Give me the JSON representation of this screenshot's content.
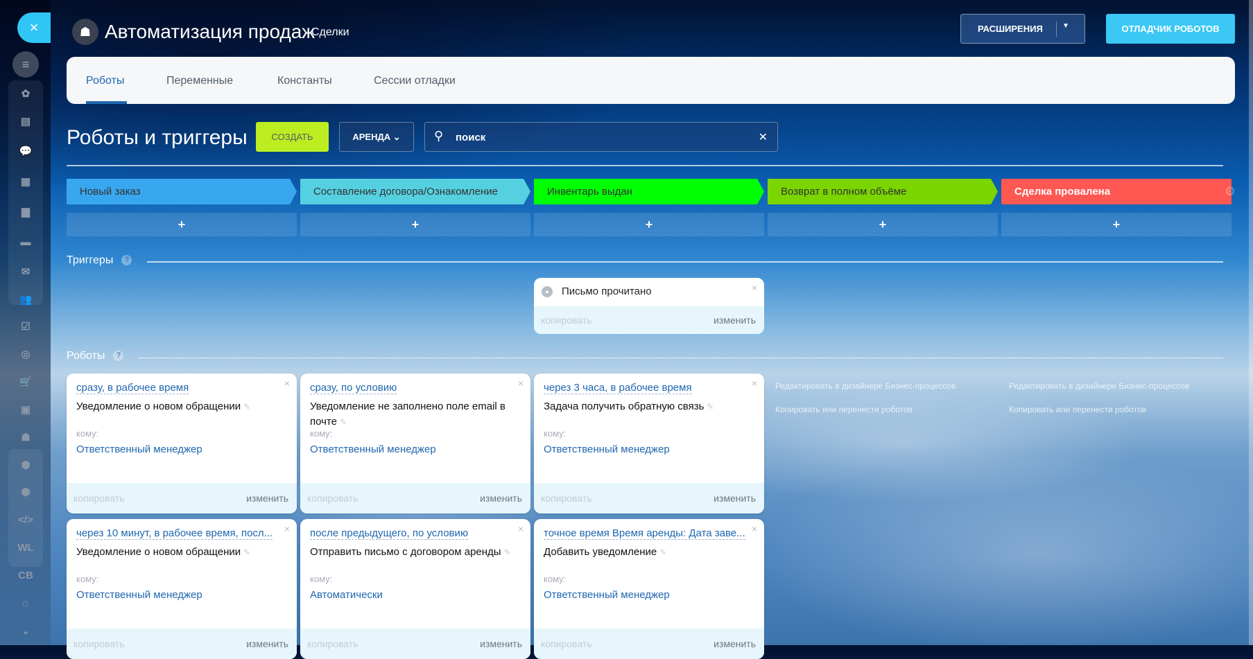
{
  "header": {
    "title": "Автоматизация продаж",
    "subtitle": "Сделки",
    "extensions_label": "РАСШИРЕНИЯ",
    "debugger_label": "ОТЛАДЧИК РОБОТОВ"
  },
  "sidebar": {
    "close": "×",
    "items": [
      {
        "icon": "funnel-icon",
        "g": "≡"
      },
      {
        "icon": "crm-icon",
        "g": "✿"
      },
      {
        "icon": "window-icon",
        "g": "▤"
      },
      {
        "icon": "chat-icon",
        "g": "💬"
      },
      {
        "icon": "calendar-icon",
        "g": "▦"
      },
      {
        "icon": "document-icon",
        "g": "▆"
      },
      {
        "icon": "drive-icon",
        "g": "▬"
      },
      {
        "icon": "mail-icon",
        "g": "✉"
      },
      {
        "icon": "users-icon",
        "g": "👥"
      },
      {
        "icon": "tasks-icon",
        "g": "☑"
      },
      {
        "icon": "target-icon",
        "g": "◎"
      },
      {
        "icon": "cart-icon",
        "g": "🛒"
      },
      {
        "icon": "contact-card-icon",
        "g": "▣"
      },
      {
        "icon": "robot-icon",
        "g": "☗"
      },
      {
        "icon": "box-icon",
        "g": "⬢"
      },
      {
        "icon": "box-2-icon",
        "g": "⬢"
      },
      {
        "icon": "code-icon",
        "g": "</>"
      },
      {
        "icon": "wl-icon",
        "g": "WL"
      },
      {
        "icon": "cb-icon",
        "g": "CB"
      },
      {
        "icon": "bank-icon",
        "g": "⌂"
      },
      {
        "icon": "more-icon",
        "g": "⌄"
      }
    ]
  },
  "tabs": [
    "Роботы",
    "Переменные",
    "Константы",
    "Сессии отладки"
  ],
  "toolbar": {
    "heading": "Роботы и триггеры",
    "create_label": "СОЗДАТЬ",
    "category_label": "АРЕНДА",
    "search_value": "",
    "search_placeholder": "поиск"
  },
  "stages": [
    {
      "name": "Новый заказ",
      "color": "#39a7ef",
      "text": "#333"
    },
    {
      "name": "Составление договора/Ознакомление",
      "color": "#55d0e0",
      "text": "#333"
    },
    {
      "name": "Инвентарь выдан",
      "color": "#00ff00",
      "text": "#333"
    },
    {
      "name": "Возврат в полном объёме",
      "color": "#7bd500",
      "text": "#333"
    },
    {
      "name": "Сделка провалена",
      "color": "#ff5752",
      "text": "#fff"
    }
  ],
  "plus": "+",
  "triggers_heading": "Триггеры",
  "robots_heading": "Роботы",
  "help": "?",
  "trigger": {
    "title": "Письмо прочитано",
    "copy": "копировать",
    "edit": "изменить"
  },
  "robots": [
    {
      "cond": "сразу, в рабочее время",
      "name": "Уведомление о новом обращении",
      "to": "кому:",
      "who": "Ответственный менеджер"
    },
    {
      "cond": "сразу, по условию",
      "name": "Уведомление не заполнено поле email в почте",
      "to": "кому:",
      "who": "Ответственный менеджер"
    },
    {
      "cond": "через 3 часа, в рабочее время",
      "name": "Задача получить обратную связь",
      "to": "кому:",
      "who": "Ответственный менеджер"
    },
    {
      "cond": "через 10 минут, в рабочее время, посл...",
      "name": "Уведомление о новом обращении",
      "to": "кому:",
      "who": "Ответственный менеджер"
    },
    {
      "cond": "после предыдущего, по условию",
      "name": "Отправить письмо с договором аренды",
      "to": "кому:",
      "who": "Автоматически"
    },
    {
      "cond": "точное время Время аренды: Дата заве...",
      "name": "Добавить уведомление",
      "to": "кому:",
      "who": "Ответственный менеджер"
    }
  ],
  "card_actions": {
    "copy": "копировать",
    "edit": "изменить"
  },
  "stage_links": [
    {
      "edit": "Редактировать в дизайнере Бизнес-процессов",
      "copy": "Копировать или перенести роботов"
    },
    {
      "edit": "Редактировать в дизайнере Бизнес-процессов",
      "copy": "Копировать или перенести роботов"
    }
  ]
}
